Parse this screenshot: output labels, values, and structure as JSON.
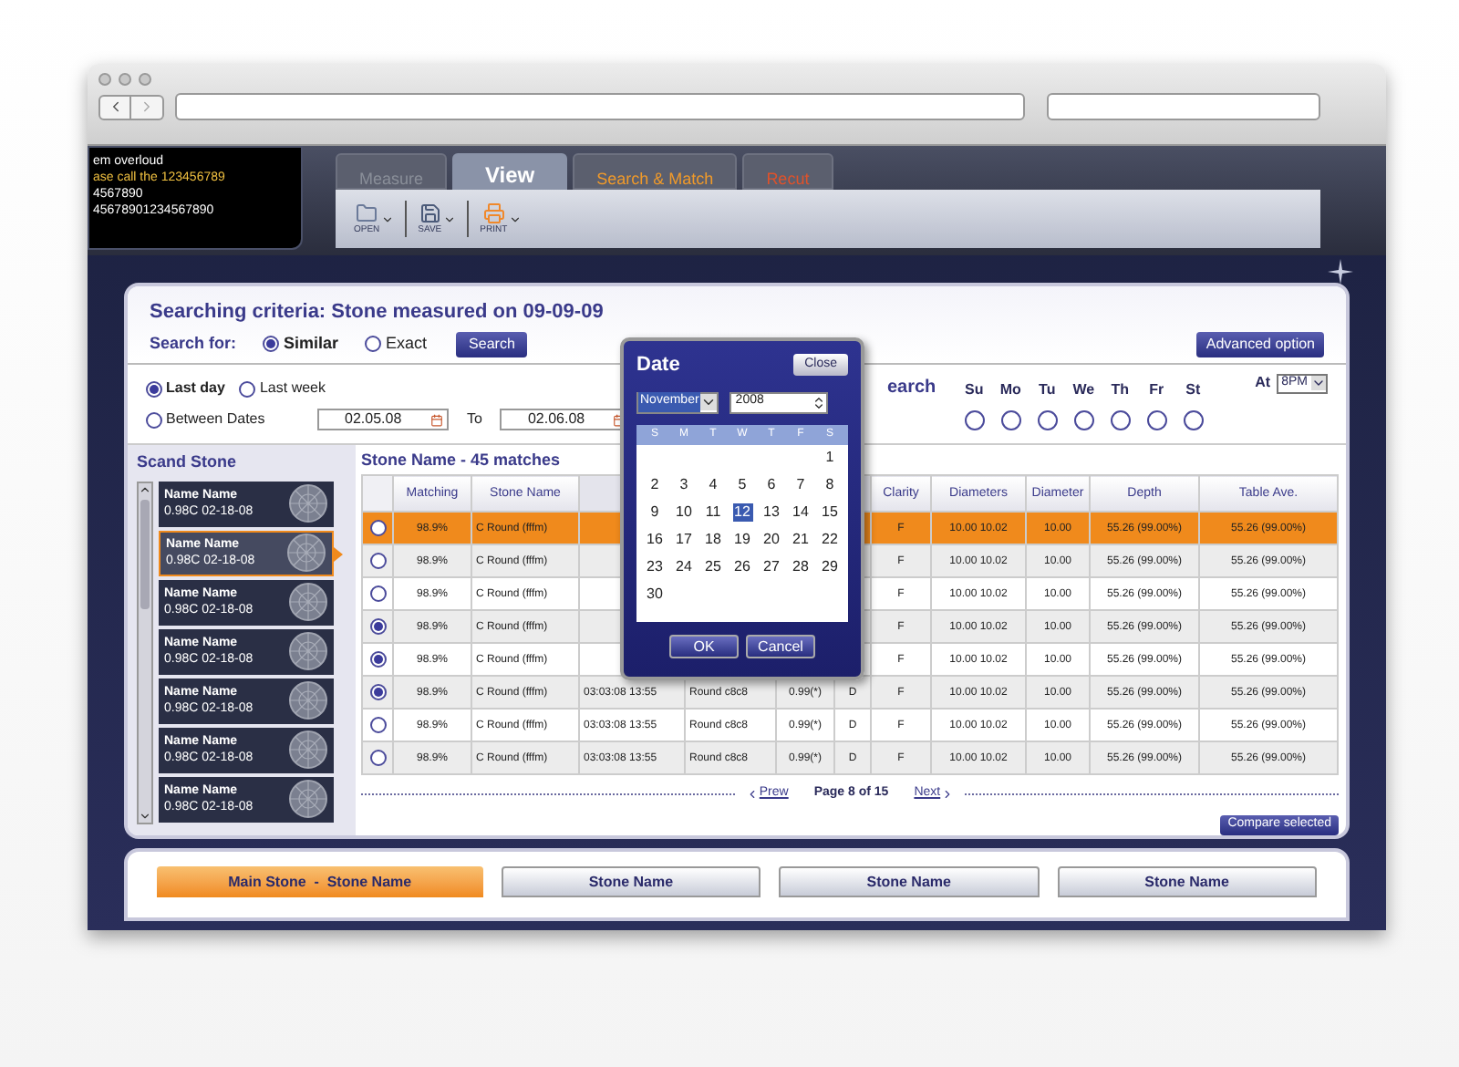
{
  "messages": [
    {
      "text": "em overloud",
      "kind": "info"
    },
    {
      "text": "ase call the 123456789",
      "kind": "warning"
    },
    {
      "text": "4567890",
      "kind": "info"
    },
    {
      "text": "45678901234567890",
      "kind": "info"
    }
  ],
  "tabs": [
    {
      "label": "Measure",
      "selected": false,
      "color": "#8a8f99"
    },
    {
      "label": "View",
      "selected": true,
      "color": "#ffffff"
    },
    {
      "label": "Search & Match",
      "selected": false,
      "color": "#f09a2a"
    },
    {
      "label": "Recut",
      "selected": false,
      "color": "#e0522a"
    }
  ],
  "toolbar": [
    {
      "label": "OPEN",
      "kind": "open"
    },
    {
      "label": "SAVE",
      "kind": "save"
    },
    {
      "label": "PRINT",
      "kind": "print"
    }
  ],
  "criteria": {
    "title": "Searching criteria: Stone measured on 09-09-09",
    "search_for_label": "Search for:",
    "options": [
      {
        "label": "Similar",
        "selected": true
      },
      {
        "label": "Exact",
        "selected": false
      }
    ],
    "search_button": "Search",
    "advanced_button": "Advanced option"
  },
  "period": {
    "options": [
      {
        "label": "Last day",
        "selected": true
      },
      {
        "label": "Last week",
        "selected": false
      },
      {
        "label": "Between Dates",
        "selected": false
      }
    ],
    "from": "02.05.08",
    "to_label": "To",
    "to": "02.06.08"
  },
  "schedule": {
    "label": "earch",
    "days": [
      {
        "label": "Su",
        "checked": false
      },
      {
        "label": "Mo",
        "checked": false
      },
      {
        "label": "Tu",
        "checked": false
      },
      {
        "label": "We",
        "checked": false
      },
      {
        "label": "Th",
        "checked": false
      },
      {
        "label": "Fr",
        "checked": false
      },
      {
        "label": "St",
        "checked": false
      }
    ],
    "at_label": "At",
    "time": "8PM"
  },
  "scanned": {
    "title": "Scand Stone",
    "stones": [
      {
        "name": "Name Name",
        "detail": "0.98C 02-18-08",
        "selected": false
      },
      {
        "name": "Name Name",
        "detail": "0.98C 02-18-08",
        "selected": true
      },
      {
        "name": "Name Name",
        "detail": "0.98C 02-18-08",
        "selected": false
      },
      {
        "name": "Name Name",
        "detail": "0.98C 02-18-08",
        "selected": false
      },
      {
        "name": "Name Name",
        "detail": "0.98C 02-18-08",
        "selected": false
      },
      {
        "name": "Name Name",
        "detail": "0.98C 02-18-08",
        "selected": false
      },
      {
        "name": "Name Name",
        "detail": "0.98C 02-18-08",
        "selected": false
      }
    ]
  },
  "results": {
    "title": "Stone Name - 45 matches",
    "columns": [
      {
        "kind": "text",
        "label": "Matching"
      },
      {
        "kind": "text",
        "label": "Stone Name"
      },
      {
        "kind": "covered"
      },
      {
        "kind": "covered"
      },
      {
        "kind": "covered"
      },
      {
        "kind": "covered"
      },
      {
        "kind": "text",
        "label": "Clarity"
      },
      {
        "kind": "text",
        "label": "Diameters"
      },
      {
        "kind": "text",
        "label": "Diameter"
      },
      {
        "kind": "text",
        "label": "Depth"
      },
      {
        "kind": "text",
        "label": "Table Ave."
      }
    ],
    "rows": [
      {
        "highlighted": true,
        "checked": false,
        "cells": [
          "98.9%",
          "C Round (fffm)",
          null,
          null,
          null,
          null,
          "F",
          "10.00 10.02",
          "10.00",
          "55.26 (99.00%)",
          "55.26 (99.00%)"
        ]
      },
      {
        "highlighted": false,
        "checked": false,
        "cells": [
          "98.9%",
          "C Round (fffm)",
          null,
          null,
          null,
          null,
          "F",
          "10.00 10.02",
          "10.00",
          "55.26 (99.00%)",
          "55.26 (99.00%)"
        ]
      },
      {
        "highlighted": false,
        "checked": false,
        "cells": [
          "98.9%",
          "C Round (fffm)",
          null,
          null,
          null,
          null,
          "F",
          "10.00 10.02",
          "10.00",
          "55.26 (99.00%)",
          "55.26 (99.00%)"
        ]
      },
      {
        "highlighted": false,
        "checked": true,
        "cells": [
          "98.9%",
          "C Round (fffm)",
          null,
          null,
          null,
          null,
          "F",
          "10.00 10.02",
          "10.00",
          "55.26 (99.00%)",
          "55.26 (99.00%)"
        ]
      },
      {
        "highlighted": false,
        "checked": true,
        "cells": [
          "98.9%",
          "C Round (fffm)",
          null,
          null,
          null,
          null,
          "F",
          "10.00 10.02",
          "10.00",
          "55.26 (99.00%)",
          "55.26 (99.00%)"
        ]
      },
      {
        "highlighted": false,
        "checked": true,
        "cells": [
          "98.9%",
          "C Round (fffm)",
          "03:03:08 13:55",
          "Round c8c8",
          "0.99(*)",
          "D",
          "F",
          "10.00 10.02",
          "10.00",
          "55.26 (99.00%)",
          "55.26 (99.00%)"
        ]
      },
      {
        "highlighted": false,
        "checked": false,
        "cells": [
          "98.9%",
          "C Round (fffm)",
          "03:03:08 13:55",
          "Round c8c8",
          "0.99(*)",
          "D",
          "F",
          "10.00 10.02",
          "10.00",
          "55.26 (99.00%)",
          "55.26 (99.00%)"
        ]
      },
      {
        "highlighted": false,
        "checked": false,
        "cells": [
          "98.9%",
          "C Round (fffm)",
          "03:03:08 13:55",
          "Round c8c8",
          "0.99(*)",
          "D",
          "F",
          "10.00 10.02",
          "10.00",
          "55.26 (99.00%)",
          "55.26 (99.00%)"
        ]
      }
    ],
    "pager": {
      "prev": "Prew",
      "page": "Page 8 of 15",
      "next": "Next"
    },
    "compare_button": "Compare selected"
  },
  "comparison": [
    {
      "label": "Main Stone  -  Stone Name",
      "main": true
    },
    {
      "label": "Stone Name",
      "main": false
    },
    {
      "label": "Stone Name",
      "main": false
    },
    {
      "label": "Stone Name",
      "main": false
    }
  ],
  "date_dialog": {
    "title": "Date",
    "close": "Close",
    "month": "November",
    "year": "2008",
    "weekdays": [
      "S",
      "M",
      "T",
      "W",
      "T",
      "F",
      "S"
    ],
    "weeks": [
      [
        {
          "kind": "blank"
        },
        {
          "kind": "blank"
        },
        {
          "kind": "blank"
        },
        {
          "kind": "blank"
        },
        {
          "kind": "blank"
        },
        {
          "kind": "blank"
        },
        {
          "kind": "day",
          "label": "1",
          "selected": false
        }
      ],
      [
        {
          "kind": "day",
          "label": "2",
          "selected": false
        },
        {
          "kind": "day",
          "label": "3",
          "selected": false
        },
        {
          "kind": "day",
          "label": "4",
          "selected": false
        },
        {
          "kind": "day",
          "label": "5",
          "selected": false
        },
        {
          "kind": "day",
          "label": "6",
          "selected": false
        },
        {
          "kind": "day",
          "label": "7",
          "selected": false
        },
        {
          "kind": "day",
          "label": "8",
          "selected": false
        }
      ],
      [
        {
          "kind": "day",
          "label": "9",
          "selected": false
        },
        {
          "kind": "day",
          "label": "10",
          "selected": false
        },
        {
          "kind": "day",
          "label": "11",
          "selected": false
        },
        {
          "kind": "day",
          "label": "12",
          "selected": true
        },
        {
          "kind": "day",
          "label": "13",
          "selected": false
        },
        {
          "kind": "day",
          "label": "14",
          "selected": false
        },
        {
          "kind": "day",
          "label": "15",
          "selected": false
        }
      ],
      [
        {
          "kind": "day",
          "label": "16",
          "selected": false
        },
        {
          "kind": "day",
          "label": "17",
          "selected": false
        },
        {
          "kind": "day",
          "label": "18",
          "selected": false
        },
        {
          "kind": "day",
          "label": "19",
          "selected": false
        },
        {
          "kind": "day",
          "label": "20",
          "selected": false
        },
        {
          "kind": "day",
          "label": "21",
          "selected": false
        },
        {
          "kind": "day",
          "label": "22",
          "selected": false
        }
      ],
      [
        {
          "kind": "day",
          "label": "23",
          "selected": false
        },
        {
          "kind": "day",
          "label": "24",
          "selected": false
        },
        {
          "kind": "day",
          "label": "25",
          "selected": false
        },
        {
          "kind": "day",
          "label": "26",
          "selected": false
        },
        {
          "kind": "day",
          "label": "27",
          "selected": false
        },
        {
          "kind": "day",
          "label": "28",
          "selected": false
        },
        {
          "kind": "day",
          "label": "29",
          "selected": false
        }
      ],
      [
        {
          "kind": "day",
          "label": "30",
          "selected": false
        }
      ]
    ],
    "ok": "OK",
    "cancel": "Cancel"
  }
}
